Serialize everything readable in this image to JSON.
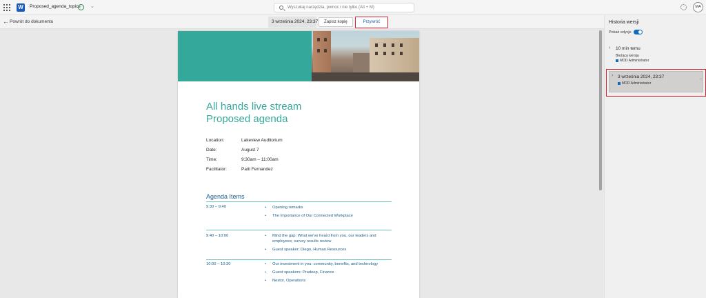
{
  "app": {
    "doc_title": "Proposed_agenda_topics",
    "search_placeholder": "Wyszukaj narzędzia, pomoc i nie tylko (Alt + M)",
    "avatar_initials": "MA",
    "word_icon_letter": "W"
  },
  "subbar": {
    "back_label": "Powrót do dokumentu",
    "version_date": "3 września 2024, 23:37",
    "save_copy_label": "Zapisz kopię",
    "restore_label": "Przywróć"
  },
  "document": {
    "title_line1": "All hands live stream",
    "title_line2": "Proposed agenda",
    "meta": [
      {
        "key": "Location:",
        "value": "Lakeview Auditorium"
      },
      {
        "key": "Date:",
        "value": "August 7"
      },
      {
        "key": "Time:",
        "value": "9:30am – 11:00am"
      },
      {
        "key": "Facilitator:",
        "value": "Patti Fernandez"
      }
    ],
    "agenda_title": "Agenda Items",
    "agenda": [
      {
        "time": "9:30 – 9:40",
        "items": [
          "Opening remarks",
          "The Importance of Our Connected Workplace"
        ]
      },
      {
        "time": "9:40 – 10:00",
        "items": [
          "Mind the gap: What we've heard from you, our leaders and employees; survey results review",
          "Guest speaker: Diego, Human Resources"
        ]
      },
      {
        "time": "10:00 – 10:30",
        "items": [
          "Our investment in you: community, benefits, and technology",
          "Guest speakers: Pradeep, Finance",
          "Nestor, Operations"
        ]
      }
    ]
  },
  "panel": {
    "title": "Historia wersji",
    "show_edits_label": "Pokaż edycje",
    "show_edits_on": true,
    "versions": [
      {
        "time": "10 min temu",
        "sub": "Bieżąca wersja",
        "author": "MOD Administrator"
      },
      {
        "time": "3 września 2024, 23:37",
        "author": "MOD Administrator",
        "more": "···"
      }
    ]
  },
  "colors": {
    "accent_teal": "#35a89c",
    "heading_blue": "#1d5c8a",
    "highlight_red": "#d1232e",
    "brand_blue": "#0f6cbd"
  }
}
